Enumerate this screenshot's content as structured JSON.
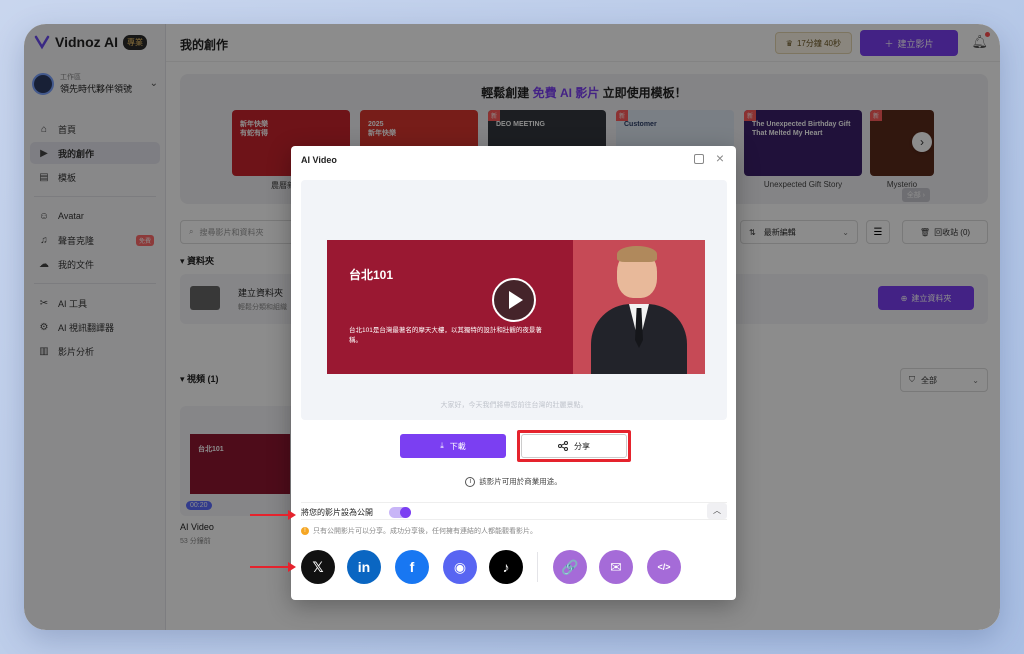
{
  "app": {
    "logo_text": "Vidnoz AI",
    "logo_badge": "專業"
  },
  "workspace": {
    "label": "工作區",
    "name": "領先時代夥伴領號"
  },
  "sidebar": {
    "items": [
      {
        "label": "首頁",
        "icon": "home-icon"
      },
      {
        "label": "我的創作",
        "icon": "play-square-icon"
      },
      {
        "label": "模板",
        "icon": "template-icon"
      },
      {
        "label": "Avatar",
        "icon": "avatar-icon"
      },
      {
        "label": "聲音克隆",
        "icon": "voice-icon",
        "tag": "免費"
      },
      {
        "label": "我的文件",
        "icon": "upload-icon"
      },
      {
        "label": "AI 工具",
        "icon": "tools-icon"
      },
      {
        "label": "AI 視訊翻譯器",
        "icon": "translate-icon"
      },
      {
        "label": "影片分析",
        "icon": "analytics-icon"
      }
    ]
  },
  "header": {
    "title": "我的創作",
    "credits": "17分鐘 40秒",
    "create_video": "建立影片"
  },
  "banner": {
    "title_pre": "輕鬆創建",
    "title_hl": "免費 AI 影片",
    "title_post": "立即使用模板！",
    "all_label": "全部",
    "templates": [
      {
        "name": "農曆新年蛇",
        "color": "#c8242c",
        "thumb_text": "新年快樂\n有蛇有得",
        "new": false
      },
      {
        "name": "",
        "color": "#d9362f",
        "thumb_text": "2025\n新年快樂",
        "new": false
      },
      {
        "name": "",
        "color": "#34383f",
        "thumb_text": "DEO MEETING",
        "new": true
      },
      {
        "name": "",
        "color": "#dfe7f2",
        "thumb_text": "Customer",
        "new": true
      },
      {
        "name": "Unexpected Gift Story",
        "color": "#3b1f6b",
        "thumb_text": "The Unexpected Birthday Gift That Melted My Heart",
        "new": true
      },
      {
        "name": "Mysterio",
        "color": "#5a2a1a",
        "thumb_text": "",
        "new": true
      }
    ]
  },
  "toolbar": {
    "search_placeholder": "搜尋影片和資料夾",
    "sort_label": "最新編輯",
    "trash_label": "回收站 (0)"
  },
  "folders": {
    "section_title": "資料夾",
    "create_title": "建立資料夾",
    "create_sub": "輕鬆分類和組織",
    "create_button": "建立資料夾"
  },
  "videos": {
    "section_title": "視頻 (1)",
    "filter_label": "全部",
    "items": [
      {
        "title": "AI Video",
        "time": "53 分鐘前",
        "duration": "00:20",
        "thumb_title": "台北101"
      }
    ]
  },
  "modal": {
    "title": "AI Video",
    "preview": {
      "title": "台北101",
      "description": "台北101是台灣最著名的摩天大樓，以其獨特的設計和壯觀的夜景著稱。",
      "caption": "大家好，今天我們將帶您前往台灣的壯麗景點。"
    },
    "download_label": "下載",
    "share_label": "分享",
    "commercial_note": "該影片可用於商業用途。",
    "public_label": "將您的影片設為公開",
    "public_on": true,
    "public_note": "只有公開影片可以分享。成功分享後，任何擁有連結的人都能觀看影片。",
    "social": [
      {
        "name": "x-icon",
        "glyph": "𝕏",
        "color": "#111111"
      },
      {
        "name": "linkedin-icon",
        "glyph": "in",
        "color": "#0a66c2"
      },
      {
        "name": "facebook-icon",
        "glyph": "f",
        "color": "#1877f2"
      },
      {
        "name": "discord-icon",
        "glyph": "◉",
        "color": "#5865f2"
      },
      {
        "name": "tiktok-icon",
        "glyph": "♪",
        "color": "#000000"
      },
      {
        "name": "link-icon",
        "glyph": "🔗",
        "color": "#a56bd8"
      },
      {
        "name": "email-icon",
        "glyph": "✉",
        "color": "#a56bd8"
      },
      {
        "name": "embed-icon",
        "glyph": "</>",
        "color": "#a56bd8"
      }
    ]
  },
  "colors": {
    "accent": "#7b3ff2",
    "annotation": "#e5232d"
  }
}
